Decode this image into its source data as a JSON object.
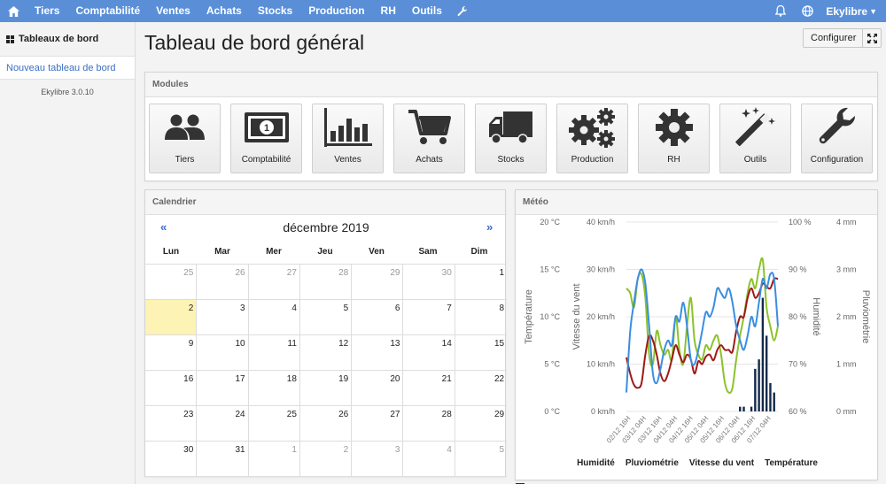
{
  "navbar": {
    "items": [
      "Tiers",
      "Comptabilité",
      "Ventes",
      "Achats",
      "Stocks",
      "Production",
      "RH",
      "Outils"
    ],
    "user": "Ekylibre",
    "color": "#5a8fd8"
  },
  "sidebar": {
    "title": "Tableaux de bord",
    "active_item": "Nouveau tableau de bord",
    "version": "Ekylibre 3.0.10"
  },
  "page": {
    "title": "Tableau de bord général",
    "configure_label": "Configurer"
  },
  "modules": {
    "title": "Modules",
    "items": [
      {
        "label": "Tiers",
        "icon": "users-icon"
      },
      {
        "label": "Comptabilité",
        "icon": "banknote-icon"
      },
      {
        "label": "Ventes",
        "icon": "bar-chart-icon"
      },
      {
        "label": "Achats",
        "icon": "cart-icon"
      },
      {
        "label": "Stocks",
        "icon": "truck-icon"
      },
      {
        "label": "Production",
        "icon": "gears-icon"
      },
      {
        "label": "RH",
        "icon": "gear-icon"
      },
      {
        "label": "Outils",
        "icon": "magic-wand-icon"
      },
      {
        "label": "Configuration",
        "icon": "wrench-icon"
      }
    ]
  },
  "calendar": {
    "title": "Calendrier",
    "prev": "«",
    "next": "»",
    "month": "décembre 2019",
    "weekdays": [
      "Lun",
      "Mar",
      "Mer",
      "Jeu",
      "Ven",
      "Sam",
      "Dim"
    ],
    "weeks": [
      [
        "25",
        "26",
        "27",
        "28",
        "29",
        "30",
        "1"
      ],
      [
        "2",
        "3",
        "4",
        "5",
        "6",
        "7",
        "8"
      ],
      [
        "9",
        "10",
        "11",
        "12",
        "13",
        "14",
        "15"
      ],
      [
        "16",
        "17",
        "18",
        "19",
        "20",
        "21",
        "22"
      ],
      [
        "23",
        "24",
        "25",
        "26",
        "27",
        "28",
        "29"
      ],
      [
        "30",
        "31",
        "1",
        "2",
        "3",
        "4",
        "5"
      ]
    ],
    "today": "2",
    "today_color": "#fcf3b4"
  },
  "weather": {
    "title": "Météo"
  },
  "chart_data": {
    "type": "line",
    "axes": [
      {
        "label": "Température",
        "ticks": [
          "0 °C",
          "5 °C",
          "10 °C",
          "15 °C",
          "20 °C"
        ],
        "range": [
          0,
          20
        ]
      },
      {
        "label": "Vitesse du vent",
        "ticks": [
          "0 km/h",
          "10 km/h",
          "20 km/h",
          "30 km/h",
          "40 km/h"
        ],
        "range": [
          0,
          40
        ]
      },
      {
        "label": "Humidité",
        "ticks": [
          "60 %",
          "70 %",
          "80 %",
          "90 %",
          "100 %"
        ],
        "range": [
          60,
          100
        ]
      },
      {
        "label": "Pluviométrie",
        "ticks": [
          "0 mm",
          "1 mm",
          "2 mm",
          "3 mm",
          "4 mm"
        ],
        "range": [
          0,
          4
        ]
      }
    ],
    "x_ticks": [
      "02/12 16H",
      "03/12 04H",
      "03/12 16H",
      "04/12 04H",
      "04/12 16H",
      "05/12 04H",
      "05/12 16H",
      "06/12 04H",
      "06/12 16H",
      "07/12 04H"
    ],
    "series": [
      {
        "name": "Humidité",
        "type": "line",
        "color": "#3a8ee0",
        "axis": "%",
        "x": [
          0,
          1,
          2,
          3,
          4,
          5,
          6,
          7,
          8,
          9,
          10,
          11,
          12,
          13,
          14,
          15,
          16,
          17,
          18,
          19,
          20,
          21,
          22,
          23,
          24,
          25,
          26,
          27,
          28,
          29,
          30,
          31,
          32,
          33,
          34,
          35,
          36,
          37,
          38,
          39,
          40
        ],
        "values": [
          64,
          77,
          83,
          88,
          90,
          87,
          78,
          68,
          66,
          69,
          73,
          75,
          74,
          80,
          79,
          83,
          78,
          71,
          70,
          73,
          77,
          81,
          80,
          82,
          86,
          85,
          84,
          86,
          83,
          78,
          75,
          73,
          76,
          80,
          78,
          83,
          88,
          86,
          89,
          88,
          78
        ]
      },
      {
        "name": "Pluviométrie",
        "type": "bar",
        "color": "#13294b",
        "axis": "mm",
        "x": [
          30,
          31,
          32,
          33,
          34,
          35,
          36,
          37,
          38,
          39
        ],
        "values": [
          0.1,
          0.1,
          0,
          0.1,
          0.9,
          1.1,
          2.4,
          1.6,
          0.6,
          0.4
        ]
      },
      {
        "name": "Vitesse du vent",
        "type": "line",
        "color": "#8cc22a",
        "axis": "km/h",
        "x": [
          0,
          1,
          2,
          3,
          4,
          5,
          6,
          7,
          8,
          9,
          10,
          11,
          12,
          13,
          14,
          15,
          16,
          17,
          18,
          19,
          20,
          21,
          22,
          23,
          24,
          25,
          26,
          27,
          28,
          29,
          30,
          31,
          32,
          33,
          34,
          35,
          36,
          37,
          38,
          39,
          40
        ],
        "values": [
          26,
          25,
          22,
          28,
          29,
          24,
          12,
          10,
          17,
          14,
          12,
          13,
          11,
          20,
          13,
          10,
          18,
          24,
          15,
          12,
          11,
          14,
          13,
          15,
          16,
          12,
          6,
          4,
          5,
          11,
          16,
          20,
          25,
          28,
          26,
          30,
          32,
          22,
          18,
          15,
          18
        ]
      },
      {
        "name": "Température",
        "type": "line",
        "color": "#a01818",
        "axis": "°C",
        "x": [
          0,
          1,
          2,
          3,
          4,
          5,
          6,
          7,
          8,
          9,
          10,
          11,
          12,
          13,
          14,
          15,
          16,
          17,
          18,
          19,
          20,
          21,
          22,
          23,
          24,
          25,
          26,
          27,
          28,
          29,
          30,
          31,
          32,
          33,
          34,
          35,
          36,
          37,
          38,
          39,
          40
        ],
        "values": [
          5.7,
          4,
          2.8,
          2.5,
          3,
          6,
          8,
          7.5,
          6,
          4,
          3.2,
          4,
          5.5,
          7,
          6,
          5.2,
          6,
          5.5,
          4,
          5.3,
          5,
          5.8,
          6,
          5.4,
          6.5,
          7,
          6.5,
          6.5,
          6.3,
          8.5,
          10,
          10,
          12,
          13,
          12,
          12.5,
          13.5,
          13.2,
          13,
          14,
          14
        ]
      }
    ]
  }
}
